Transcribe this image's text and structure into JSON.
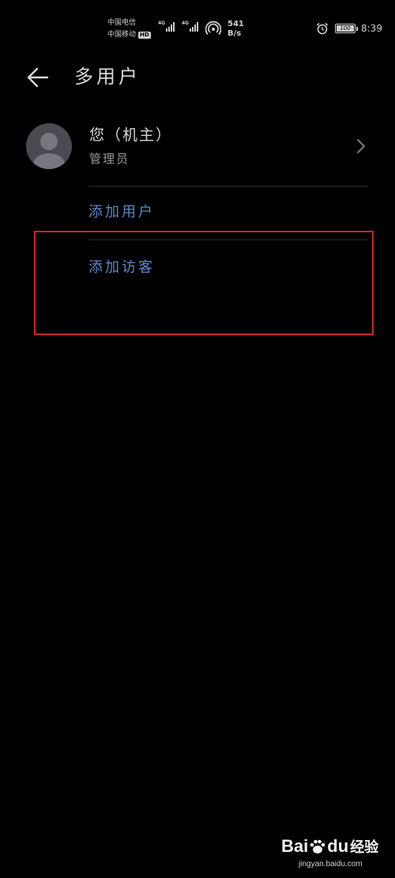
{
  "status_bar": {
    "carrier_1": "中国电信",
    "carrier_2": "中国移动",
    "hd_badge": "HD",
    "network_1": "4G",
    "network_2": "4G",
    "speed_value": "541",
    "speed_unit": "B/s",
    "battery": "100",
    "time": "8:39"
  },
  "header": {
    "title": "多用户"
  },
  "user": {
    "name": "您（机主）",
    "role": "管理员"
  },
  "actions": {
    "add_user": "添加用户",
    "add_guest": "添加访客"
  },
  "colors": {
    "background": "#000000",
    "action_text": "#5c86c8",
    "highlight_border": "#d0222a",
    "avatar_bg": "#4b4a53"
  },
  "watermark": {
    "logo_left": "Bai",
    "logo_right": "du",
    "logo_suffix": "经验",
    "url": "jingyan.baidu.com"
  }
}
